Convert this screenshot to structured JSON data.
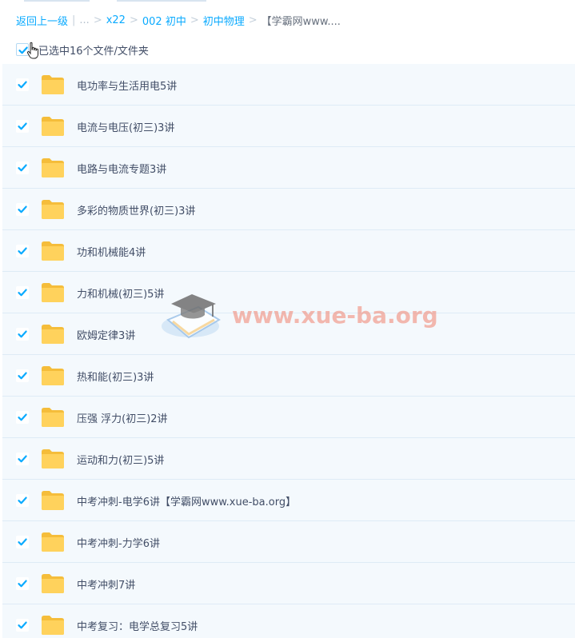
{
  "breadcrumb": {
    "back": "返回上一级",
    "ellipsis": "...",
    "items": [
      "x22",
      "002 初中",
      "初中物理"
    ],
    "current": "【学霸网www...."
  },
  "selection": {
    "label": "已选中16个文件/文件夹"
  },
  "files": [
    {
      "name": "电功率与生活用电5讲",
      "checked": true,
      "icon": "folder-icon"
    },
    {
      "name": "电流与电压(初三)3讲",
      "checked": true,
      "icon": "folder-icon"
    },
    {
      "name": "电路与电流专题3讲",
      "checked": true,
      "icon": "folder-icon"
    },
    {
      "name": "多彩的物质世界(初三)3讲",
      "checked": true,
      "icon": "folder-icon"
    },
    {
      "name": "功和机械能4讲",
      "checked": true,
      "icon": "folder-icon"
    },
    {
      "name": "力和机械(初三)5讲",
      "checked": true,
      "icon": "folder-icon"
    },
    {
      "name": "欧姆定律3讲",
      "checked": true,
      "icon": "folder-icon"
    },
    {
      "name": "热和能(初三)3讲",
      "checked": true,
      "icon": "folder-icon"
    },
    {
      "name": "压强 浮力(初三)2讲",
      "checked": true,
      "icon": "folder-icon"
    },
    {
      "name": "运动和力(初三)5讲",
      "checked": true,
      "icon": "folder-icon"
    },
    {
      "name": "中考冲刺-电学6讲【学霸网www.xue-ba.org】",
      "checked": true,
      "icon": "folder-icon"
    },
    {
      "name": "中考冲刺-力学6讲",
      "checked": true,
      "icon": "folder-icon"
    },
    {
      "name": "中考冲刺7讲",
      "checked": true,
      "icon": "folder-icon"
    },
    {
      "name": "中考复习：电学总复习5讲",
      "checked": true,
      "icon": "folder-icon"
    }
  ],
  "watermark": {
    "text": "www.xue-ba.org"
  },
  "colors": {
    "link": "#09aaff",
    "check": "#09aaff",
    "row_bg": "#f4f9fd",
    "folder": "#ffd25c"
  }
}
